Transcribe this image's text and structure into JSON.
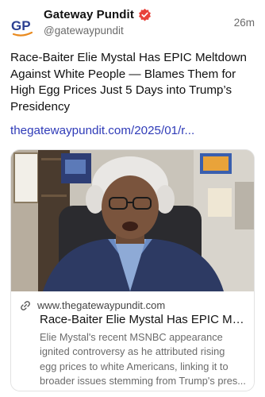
{
  "author": {
    "name": "Gateway Pundit",
    "handle": "@gatewaypundit",
    "avatar_initials": "GP",
    "verified": true
  },
  "time": "26m",
  "post_text": "Race-Baiter Elie Mystal Has EPIC Meltdown Against White People — Blames Them for High Egg Prices Just 5 Days into Trump’s Presidency",
  "post_link": "thegatewaypundit.com/2025/01/r...",
  "card": {
    "domain": "www.thegatewaypundit.com",
    "title": "Race-Baiter Elie Mystal Has EPIC Melt...",
    "description_lines": [
      "Elie Mystal's recent MSNBC appearance",
      "ignited controversy as he attributed rising",
      "egg prices to white Americans, linking it to",
      "broader issues stemming from Trump's pres..."
    ]
  },
  "colors": {
    "link": "#2f3bb8",
    "verified_badge": "#e8423a",
    "avatar_blue": "#2b3f91",
    "avatar_orange": "#e98a1f"
  },
  "icons": {
    "verified": "verified-badge-icon",
    "link": "link-icon"
  }
}
